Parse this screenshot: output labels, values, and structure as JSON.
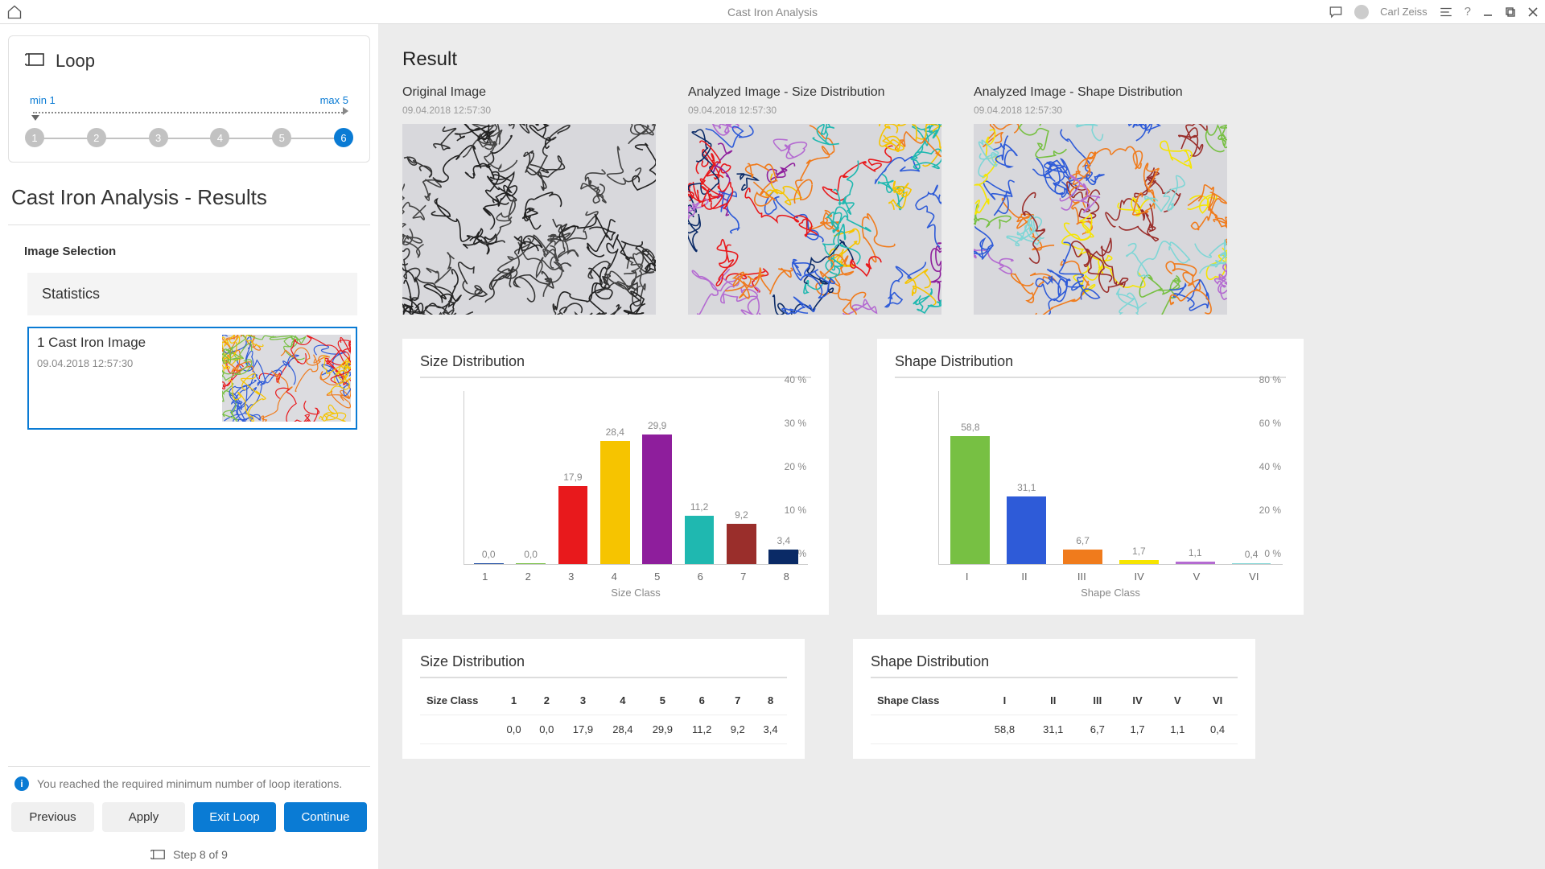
{
  "app": {
    "title": "Cast Iron Analysis",
    "user": "Carl Zeiss"
  },
  "loop": {
    "label": "Loop",
    "min_label": "min 1",
    "max_label": "max 5",
    "step_active": 6,
    "steps": [
      "1",
      "2",
      "3",
      "4",
      "5",
      "6"
    ]
  },
  "section_title": "Cast Iron Analysis - Results",
  "image_selection": {
    "label": "Image Selection",
    "stats_label": "Statistics",
    "item": {
      "name": "1 Cast Iron Image",
      "timestamp": "09.04.2018 12:57:30"
    }
  },
  "footer": {
    "info_text": "You reached the required minimum number of loop iterations.",
    "previous": "Previous",
    "apply": "Apply",
    "exit_loop": "Exit Loop",
    "continue": "Continue",
    "step_text": "Step 8 of 9"
  },
  "result": {
    "title": "Result",
    "images": [
      {
        "label": "Original Image",
        "timestamp": "09.04.2018 12:57:30"
      },
      {
        "label": "Analyzed Image - Size Distribution",
        "timestamp": "09.04.2018 12:57:30"
      },
      {
        "label": "Analyzed Image - Shape Distribution",
        "timestamp": "09.04.2018 12:57:30"
      }
    ]
  },
  "chart_data": [
    {
      "type": "bar",
      "title": "Size Distribution",
      "xlabel": "Size Class",
      "ylabel": "%",
      "ylim": [
        0,
        40
      ],
      "yticks": [
        "0 %",
        "10 %",
        "20 %",
        "30 %",
        "40 %"
      ],
      "categories": [
        "1",
        "2",
        "3",
        "4",
        "5",
        "6",
        "7",
        "8"
      ],
      "values": [
        0.0,
        0.0,
        17.9,
        28.4,
        29.9,
        11.2,
        9.2,
        3.4
      ],
      "labels": [
        "0,0",
        "0,0",
        "17,9",
        "28,4",
        "29,9",
        "11,2",
        "9,2",
        "3,4"
      ],
      "colors": [
        "#1f4ea3",
        "#77c043",
        "#e8191c",
        "#f6c400",
        "#8e1e9c",
        "#1fb8b0",
        "#9a2e2b",
        "#0a2a66"
      ]
    },
    {
      "type": "bar",
      "title": "Shape Distribution",
      "xlabel": "Shape Class",
      "ylabel": "%",
      "ylim": [
        0,
        80
      ],
      "yticks": [
        "0 %",
        "20 %",
        "40 %",
        "60 %",
        "80 %"
      ],
      "categories": [
        "I",
        "II",
        "III",
        "IV",
        "V",
        "VI"
      ],
      "values": [
        58.8,
        31.1,
        6.7,
        1.7,
        1.1,
        0.4
      ],
      "labels": [
        "58,8",
        "31,1",
        "6,7",
        "1,7",
        "1,1",
        "0,4"
      ],
      "colors": [
        "#77c043",
        "#2e5bd8",
        "#f07b1c",
        "#f6e500",
        "#b46bd1",
        "#7fd6d6"
      ]
    }
  ],
  "tables": [
    {
      "title": "Size Distribution",
      "row_header": "Size Class"
    },
    {
      "title": "Shape Distribution",
      "row_header": "Shape Class"
    }
  ]
}
